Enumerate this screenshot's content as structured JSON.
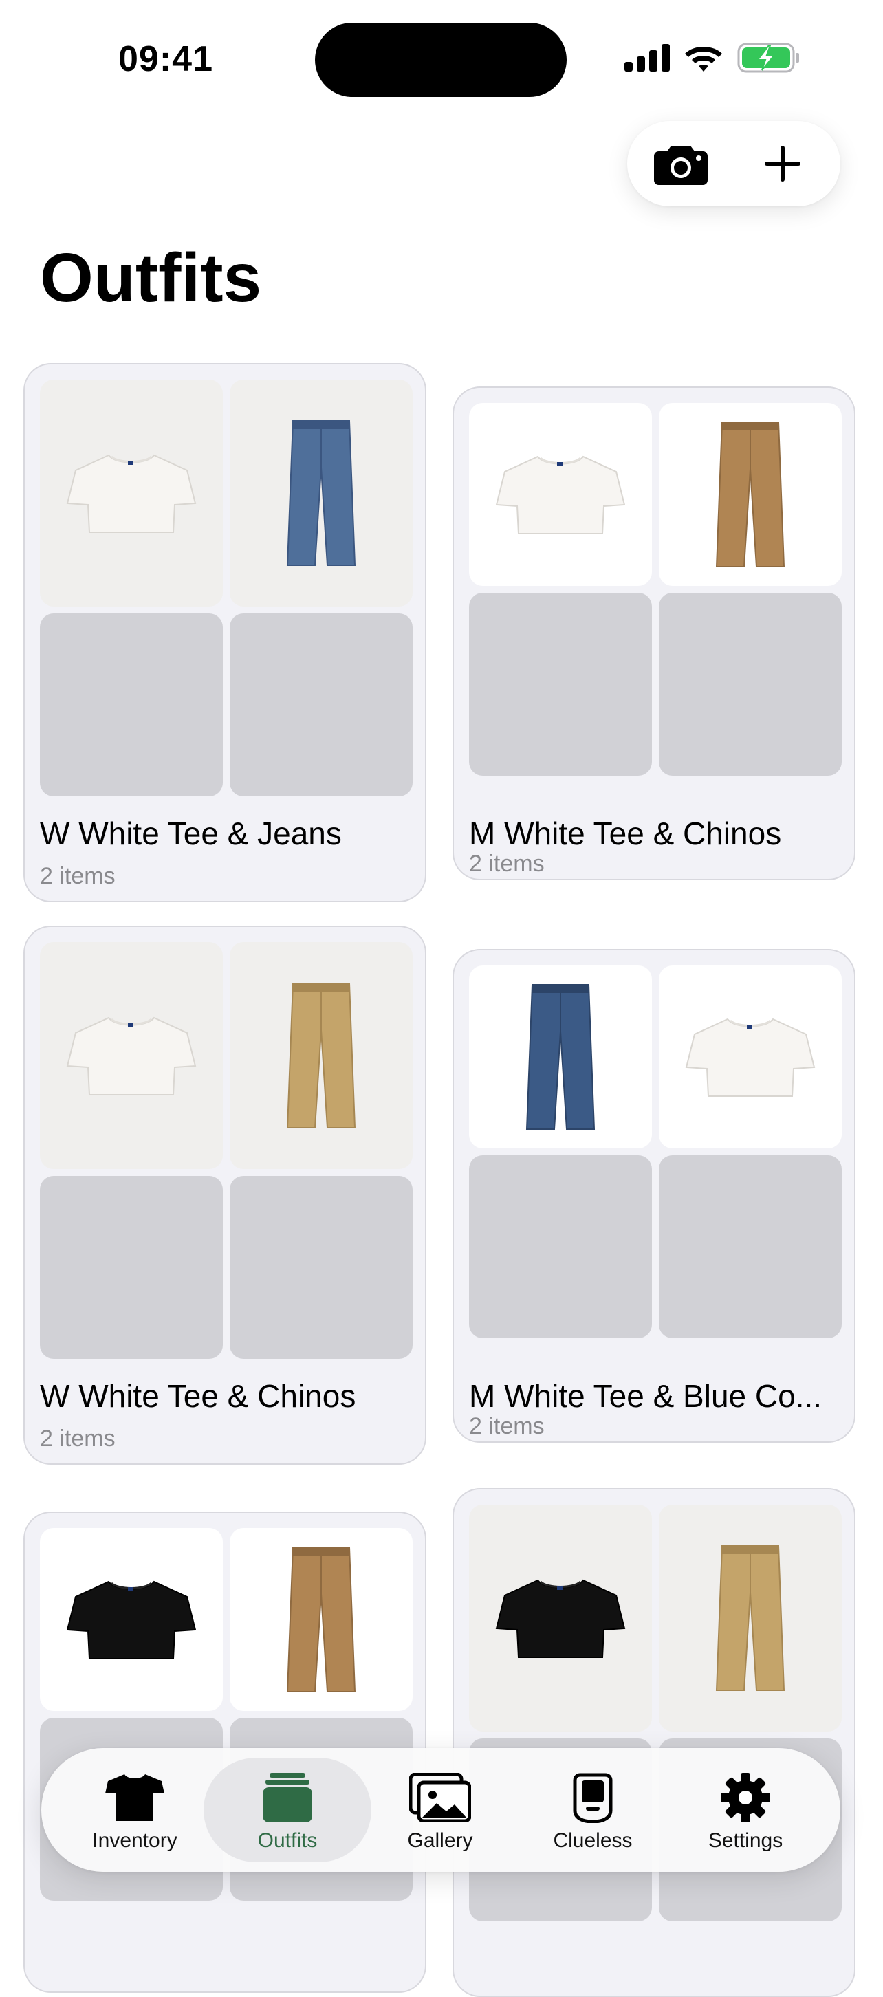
{
  "status_bar": {
    "time": "09:41"
  },
  "header": {
    "title": "Outfits"
  },
  "colors": {
    "accent": "#2f6b45",
    "battery": "#34c759",
    "card_bg": "#f2f2f7",
    "placeholder": "#d1d1d6"
  },
  "outfits": [
    {
      "title": "W White Tee & Jeans",
      "count": "2 items",
      "items": [
        "white-tee",
        "blue-jeans"
      ]
    },
    {
      "title": "M White Tee & Chinos",
      "count": "2 items",
      "items": [
        "white-tee",
        "tan-chinos"
      ]
    },
    {
      "title": "W White Tee & Chinos",
      "count": "2 items",
      "items": [
        "white-tee",
        "khaki-work-pants"
      ]
    },
    {
      "title": "M White Tee & Blue Co...",
      "count": "2 items",
      "items": [
        "dark-jeans",
        "white-tee"
      ]
    },
    {
      "title": "",
      "count": "",
      "items": [
        "black-tee",
        "tan-chinos"
      ]
    },
    {
      "title": "",
      "count": "",
      "items": [
        "black-tee",
        "khaki-work-pants"
      ]
    }
  ],
  "tabs": [
    {
      "label": "Inventory",
      "icon": "tshirt-icon",
      "active": false
    },
    {
      "label": "Outfits",
      "icon": "outfits-stack-icon",
      "active": true
    },
    {
      "label": "Gallery",
      "icon": "gallery-icon",
      "active": false
    },
    {
      "label": "Clueless",
      "icon": "clueless-phone-icon",
      "active": false
    },
    {
      "label": "Settings",
      "icon": "gear-icon",
      "active": false
    }
  ]
}
